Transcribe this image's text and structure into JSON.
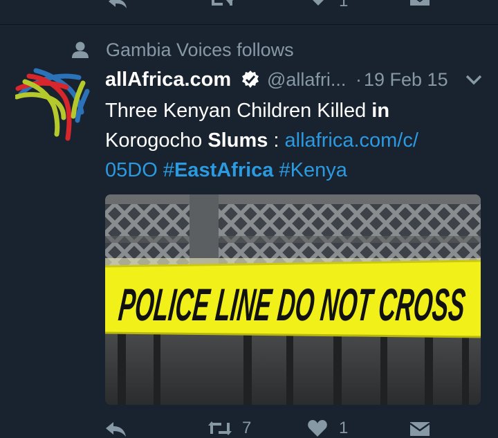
{
  "previous_tweet": {
    "reply_icon": "reply-icon",
    "retweet_icon": "retweet-icon",
    "like_icon": "heart-icon",
    "like_count": "1",
    "dm_icon": "envelope-icon"
  },
  "social_context": {
    "icon": "person-icon",
    "text": "Gambia Voices follows"
  },
  "tweet": {
    "author_name": "allAfrica.com",
    "verified_icon": "verified-badge-icon",
    "handle": "@allafri...",
    "separator": "·",
    "date": "19 Feb 15",
    "menu_icon": "chevron-down-icon",
    "text_parts": {
      "t1": "Three Kenyan Children Killed ",
      "t2": "in",
      "t3": "Korogocho ",
      "t4": "Slums",
      "t5": " : ",
      "link": "allafrica.com/c/05DO",
      "link_a": "allafrica.com/c/",
      "link_b": "05DO",
      "sp": " ",
      "hashtag1_hash": "#",
      "hashtag1_word": "EastAfrica",
      "hashtag2": "#Kenya"
    },
    "media": {
      "tape_text": "POLICE LINE DO NOT CROSS",
      "tape_color": "#f1f019"
    },
    "actions": {
      "reply_icon": "reply-icon",
      "retweet_icon": "retweet-icon",
      "retweet_count": "7",
      "like_icon": "heart-icon",
      "like_count": "1",
      "dm_icon": "envelope-icon"
    }
  },
  "colors": {
    "background": "#18232f",
    "secondary_text": "#8899a6",
    "link": "#2b9ae0"
  }
}
